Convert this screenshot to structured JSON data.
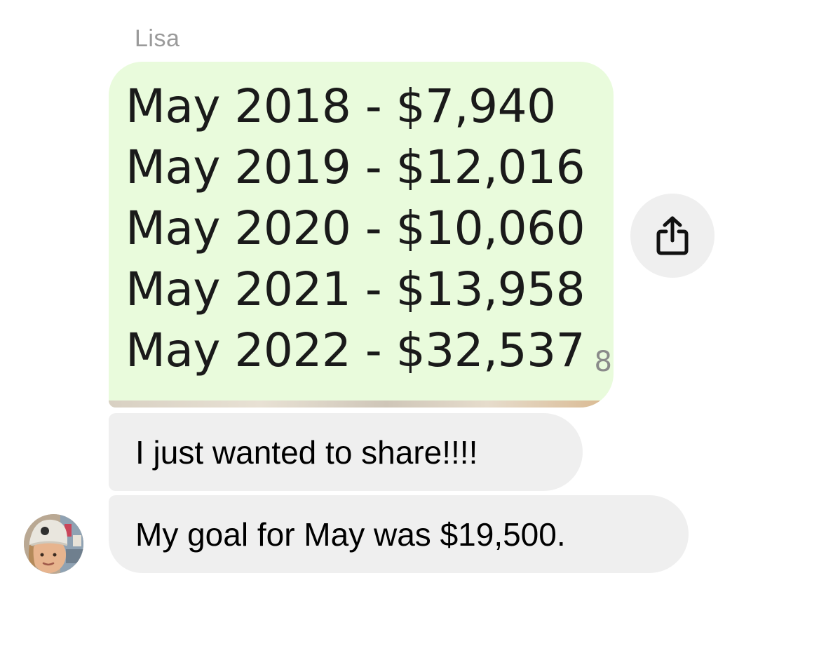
{
  "chat": {
    "sender_name": "Lisa",
    "image_message": {
      "lines": [
        "May 2018 - $7,940",
        "May 2019 - $12,016",
        "May 2020 - $10,060",
        "May 2021 - $13,958",
        "May 2022 - $32,537"
      ],
      "edge_glyph": "8"
    },
    "messages": [
      "I just wanted to share!!!!",
      "My goal for May was $19,500."
    ]
  },
  "icons": {
    "share": "share-icon",
    "avatar": "avatar"
  },
  "colors": {
    "image_background": "#e9fbdc",
    "bubble_background": "#efefef",
    "sender_name": "#9a9a9a"
  }
}
